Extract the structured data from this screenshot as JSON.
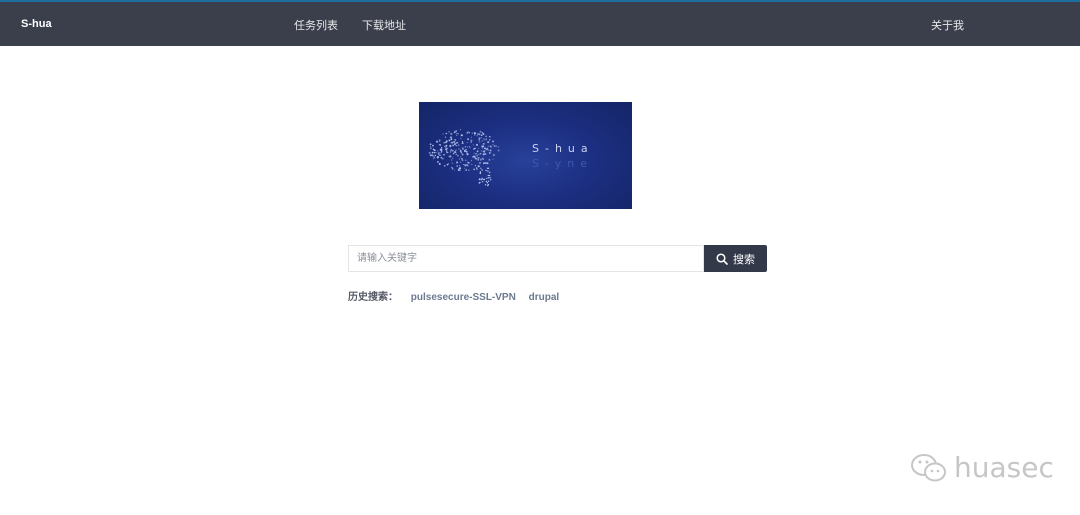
{
  "navbar": {
    "brand": "S-hua",
    "links": [
      {
        "label": "任务列表"
      },
      {
        "label": "下载地址"
      }
    ],
    "about": "关于我"
  },
  "logo": {
    "line1": "S-hua",
    "line2": "S-yne"
  },
  "search": {
    "placeholder": "请输入关键字",
    "button_label": "搜索",
    "icon": "search-icon"
  },
  "history": {
    "label": "历史搜索：",
    "items": [
      "pulsesecure-SSL-VPN",
      "drupal"
    ]
  },
  "watermark": {
    "text": "huasec",
    "icon": "wechat-icon"
  },
  "colors": {
    "navbar_bg": "#3b3f4c",
    "navbar_accent": "#1d6fa0",
    "button_bg": "#34394a",
    "logo_bg": "#1c2f82"
  }
}
